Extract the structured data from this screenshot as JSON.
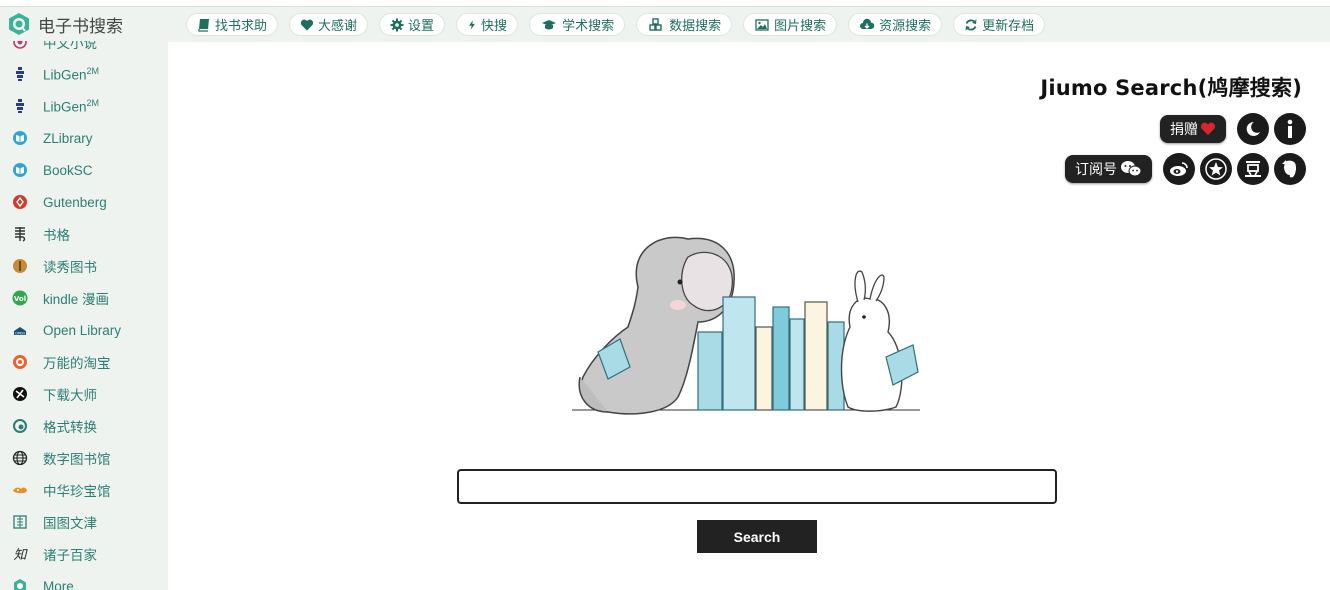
{
  "brand": {
    "title": "电子书搜索",
    "logo_icon": "jiumo-logo-icon",
    "color": "#3bb39a"
  },
  "sidebar": {
    "items": [
      {
        "label": "中文小说",
        "sup": "",
        "icon": "chinese-novel-icon",
        "color": "#c0396b"
      },
      {
        "label": "LibGen",
        "sup": "2M",
        "icon": "libgen-icon",
        "color": "#2a3b8f"
      },
      {
        "label": "LibGen",
        "sup": "2M",
        "icon": "libgen-icon",
        "color": "#2a3b8f"
      },
      {
        "label": "ZLibrary",
        "sup": "",
        "icon": "zlibrary-icon",
        "color": "#2fa4d8"
      },
      {
        "label": "BookSC",
        "sup": "",
        "icon": "booksc-icon",
        "color": "#2fa4d8"
      },
      {
        "label": "Gutenberg",
        "sup": "",
        "icon": "gutenberg-icon",
        "color": "#d33a2c"
      },
      {
        "label": "书格",
        "sup": "",
        "icon": "shuge-icon",
        "color": "#333333"
      },
      {
        "label": "读秀图书",
        "sup": "",
        "icon": "duxiu-icon",
        "color": "#c58b3b"
      },
      {
        "label": "kindle 漫画",
        "sup": "",
        "icon": "kindle-manga-icon",
        "color": "#2ea84b"
      },
      {
        "label": "Open Library",
        "sup": "",
        "icon": "openlibrary-icon",
        "color": "#1d4e7a"
      },
      {
        "label": "万能的淘宝",
        "sup": "",
        "icon": "taobao-icon",
        "color": "#f0602a"
      },
      {
        "label": "下载大师",
        "sup": "",
        "icon": "download-master-icon",
        "color": "#111111"
      },
      {
        "label": "格式转换",
        "sup": "",
        "icon": "format-convert-icon",
        "color": "#2a7f74"
      },
      {
        "label": "数字图书馆",
        "sup": "",
        "icon": "globe-icon",
        "color": "#222222"
      },
      {
        "label": "中华珍宝馆",
        "sup": "",
        "icon": "treasure-icon",
        "color": "#e8902b"
      },
      {
        "label": "国图文津",
        "sup": "",
        "icon": "national-library-icon",
        "color": "#2a7f74"
      },
      {
        "label": "诸子百家",
        "sup": "",
        "icon": "zhuzi-icon",
        "color": "#222222"
      },
      {
        "label": "More",
        "sup": "",
        "icon": "more-icon",
        "color": "#3bb39a"
      }
    ]
  },
  "topnav": {
    "items": [
      {
        "label": "找书求助",
        "icon": "book-icon"
      },
      {
        "label": "大感谢",
        "icon": "heart-icon"
      },
      {
        "label": "设置",
        "icon": "gear-icon"
      },
      {
        "label": "快搜",
        "icon": "bolt-icon"
      },
      {
        "label": "学术搜索",
        "icon": "graduation-cap-icon"
      },
      {
        "label": "数据搜索",
        "icon": "cubes-icon"
      },
      {
        "label": "图片搜索",
        "icon": "image-icon"
      },
      {
        "label": "资源搜索",
        "icon": "cloud-download-icon"
      },
      {
        "label": "更新存档",
        "icon": "refresh-icon"
      }
    ]
  },
  "header": {
    "title": "Jiumo Search(鸠摩搜索)",
    "donate_label": "捐赠",
    "subscribe_label": "订阅号"
  },
  "search": {
    "value": "",
    "placeholder": "",
    "button_label": "Search"
  }
}
